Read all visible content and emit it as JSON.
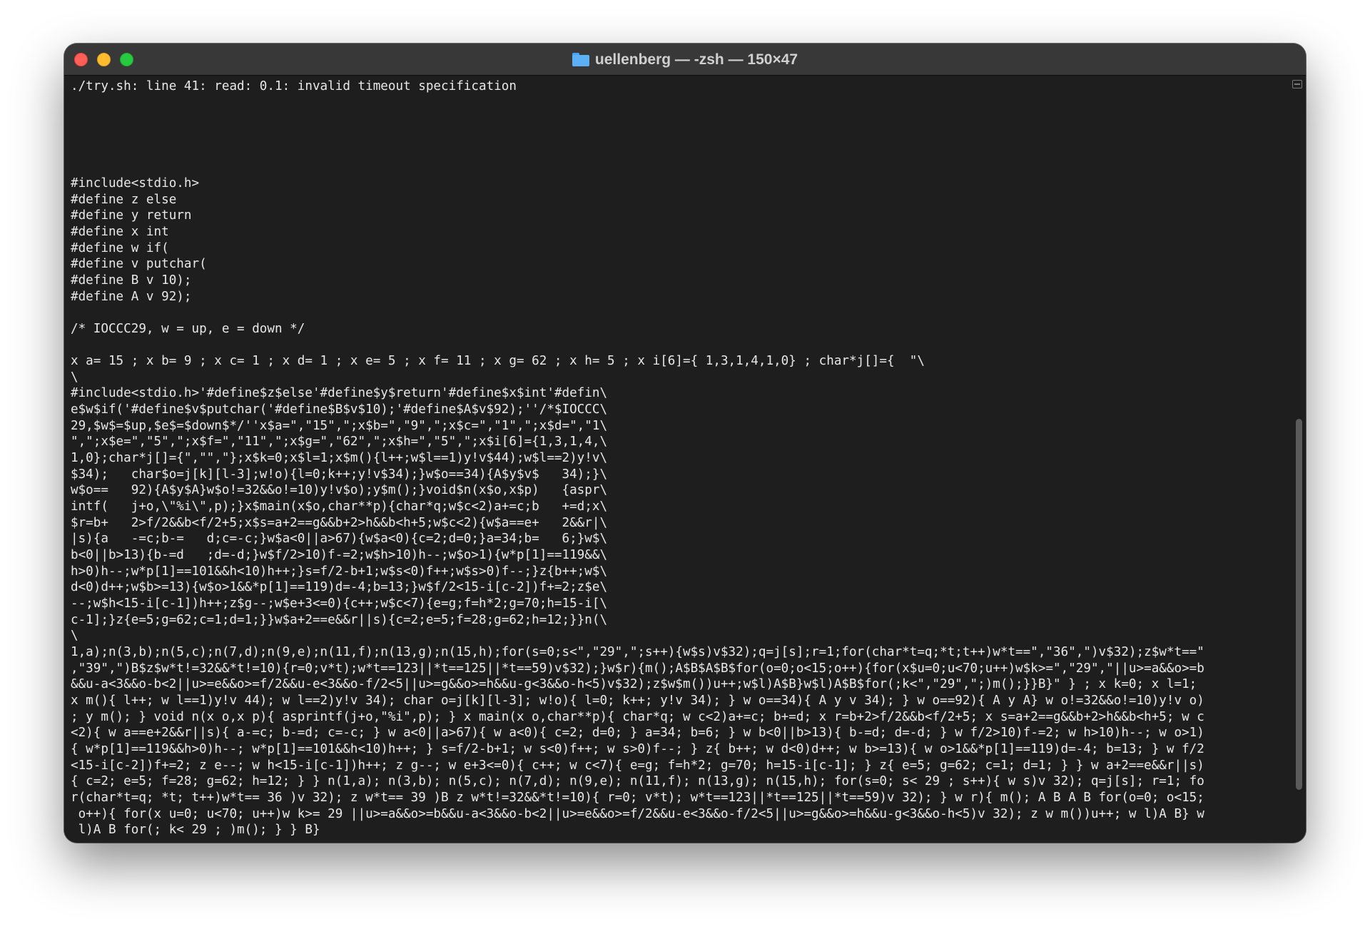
{
  "window": {
    "title": "uellenberg — -zsh — 150×47"
  },
  "terminal": {
    "lines": [
      "./try.sh: line 41: read: 0.1: invalid timeout specification",
      "",
      "",
      "",
      "",
      "",
      "#include<stdio.h>",
      "#define z else",
      "#define y return",
      "#define x int",
      "#define w if(",
      "#define v putchar(",
      "#define B v 10);",
      "#define A v 92);",
      "",
      "/* IOCCC29, w = up, e = down */",
      "",
      "x a= 15 ; x b= 9 ; x c= 1 ; x d= 1 ; x e= 5 ; x f= 11 ; x g= 62 ; x h= 5 ; x i[6]={ 1,3,1,4,1,0} ; char*j[]={  \"\\",
      "\\",
      "#include<stdio.h>'#define$z$else'#define$y$return'#define$x$int'#defin\\",
      "e$w$if('#define$v$putchar('#define$B$v$10);'#define$A$v$92);''/*$IOCCC\\",
      "29,$w$=$up,$e$=$down$*/''x$a=\",\"15\",\";x$b=\",\"9\",\";x$c=\",\"1\",\";x$d=\",\"1\\",
      "\",\";x$e=\",\"5\",\";x$f=\",\"11\",\";x$g=\",\"62\",\";x$h=\",\"5\",\";x$i[6]={1,3,1,4,\\",
      "1,0};char*j[]={\",\"\",\"};x$k=0;x$l=1;x$m(){l++;w$l==1)y!v$44);w$l==2)y!v\\",
      "$34);   char$o=j[k][l-3];w!o){l=0;k++;y!v$34);}w$o==34){A$y$v$   34);}\\",
      "w$o==   92){A$y$A}w$o!=32&&o!=10)y!v$o);y$m();}void$n(x$o,x$p)   {aspr\\",
      "intf(   j+o,\\\"%i\\\",p);}x$main(x$o,char**p){char*q;w$c<2)a+=c;b   +=d;x\\",
      "$r=b+   2>f/2&&b<f/2+5;x$s=a+2==g&&b+2>h&&b<h+5;w$c<2){w$a==e+   2&&r|\\",
      "|s){a   -=c;b-=   d;c=-c;}w$a<0||a>67){w$a<0){c=2;d=0;}a=34;b=   6;}w$\\",
      "b<0||b>13){b-=d   ;d=-d;}w$f/2>10)f-=2;w$h>10)h--;w$o>1){w*p[1]==119&&\\",
      "h>0)h--;w*p[1]==101&&h<10)h++;}s=f/2-b+1;w$s<0)f++;w$s>0)f--;}z{b++;w$\\",
      "d<0)d++;w$b>=13){w$o>1&&*p[1]==119)d=-4;b=13;}w$f/2<15-i[c-2])f+=2;z$e\\",
      "--;w$h<15-i[c-1])h++;z$g--;w$e+3<=0){c++;w$c<7){e=g;f=h*2;g=70;h=15-i[\\",
      "c-1];}z{e=5;g=62;c=1;d=1;}}w$a+2==e&&r||s){c=2;e=5;f=28;g=62;h=12;}}n(\\",
      "\\",
      "1,a);n(3,b);n(5,c);n(7,d);n(9,e);n(11,f);n(13,g);n(15,h);for(s=0;s<\",\"29\",\";s++){w$s)v$32);q=j[s];r=1;for(char*t=q;*t;t++)w*t==\",\"36\",\")v$32);z$w*t==\"",
      ",\"39\",\")B$z$w*t!=32&&*t!=10){r=0;v*t);w*t==123||*t==125||*t==59)v$32);}w$r){m();A$B$A$B$for(o=0;o<15;o++){for(x$u=0;u<70;u++)w$k>=\",\"29\",\"||u>=a&&o>=b",
      "&&u-a<3&&o-b<2||u>=e&&o>=f/2&&u-e<3&&o-f/2<5||u>=g&&o>=h&&u-g<3&&o-h<5)v$32);z$w$m())u++;w$l)A$B}w$l)A$B$for(;k<\",\"29\",\";)m();}}B}\" } ; x k=0; x l=1;",
      "x m(){ l++; w l==1)y!v 44); w l==2)y!v 34); char o=j[k][l-3]; w!o){ l=0; k++; y!v 34); } w o==34){ A y v 34); } w o==92){ A y A} w o!=32&&o!=10)y!v o)",
      "; y m(); } void n(x o,x p){ asprintf(j+o,\"%i\",p); } x main(x o,char**p){ char*q; w c<2)a+=c; b+=d; x r=b+2>f/2&&b<f/2+5; x s=a+2==g&&b+2>h&&b<h+5; w c",
      "<2){ w a==e+2&&r||s){ a-=c; b-=d; c=-c; } w a<0||a>67){ w a<0){ c=2; d=0; } a=34; b=6; } w b<0||b>13){ b-=d; d=-d; } w f/2>10)f-=2; w h>10)h--; w o>1)",
      "{ w*p[1]==119&&h>0)h--; w*p[1]==101&&h<10)h++; } s=f/2-b+1; w s<0)f++; w s>0)f--; } z{ b++; w d<0)d++; w b>=13){ w o>1&&*p[1]==119)d=-4; b=13; } w f/2",
      "<15-i[c-2])f+=2; z e--; w h<15-i[c-1])h++; z g--; w e+3<=0){ c++; w c<7){ e=g; f=h*2; g=70; h=15-i[c-1]; } z{ e=5; g=62; c=1; d=1; } } w a+2==e&&r||s)",
      "{ c=2; e=5; f=28; g=62; h=12; } } n(1,a); n(3,b); n(5,c); n(7,d); n(9,e); n(11,f); n(13,g); n(15,h); for(s=0; s< 29 ; s++){ w s)v 32); q=j[s]; r=1; fo",
      "r(char*t=q; *t; t++)w*t== 36 )v 32); z w*t== 39 )B z w*t!=32&&*t!=10){ r=0; v*t); w*t==123||*t==125||*t==59)v 32); } w r){ m(); A B A B for(o=0; o<15;",
      " o++){ for(x u=0; u<70; u++)w k>= 29 ||u>=a&&o>=b&&u-a<3&&o-b<2||u>=e&&o>=f/2&&u-e<3&&o-f/2<5||u>=g&&o>=h&&u-g<3&&o-h<5)v 32); z w m())u++; w l)A B} w",
      " l)A B for(; k< 29 ; )m(); } } B}"
    ]
  },
  "icons": {
    "title_icon": "folder-icon",
    "scroll_icon": "scroll-indicator-icon"
  },
  "colors": {
    "close": "#fe5f57",
    "minimize": "#febc2e",
    "zoom": "#28c840",
    "background": "#1e1e1e",
    "text": "#e8e8e8"
  }
}
